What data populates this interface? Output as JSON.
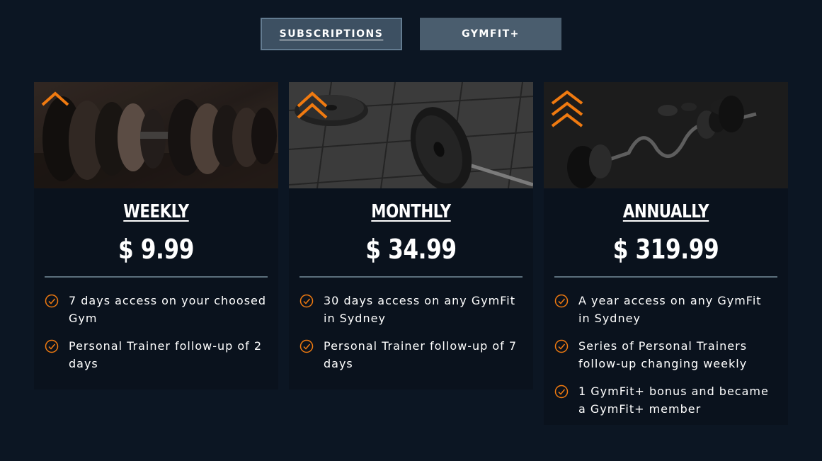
{
  "tabs": {
    "subscriptions": "SUBSCRIPTIONS",
    "gymfit_plus": "GYMFIT+"
  },
  "colors": {
    "accent": "#f07a10",
    "background": "#0c1623",
    "card": "#0a121d",
    "tab_active": "#3d5062",
    "tab_inactive": "#4a5d6e"
  },
  "plans": [
    {
      "title": "WEEKLY",
      "price": "$ 9.99",
      "tier_icon": "single-chevron-up-icon",
      "features": [
        "7 days access on your choosed Gym",
        "Personal Trainer follow-up of 2 days"
      ]
    },
    {
      "title": "MONTHLY",
      "price": "$ 34.99",
      "tier_icon": "double-chevron-up-icon",
      "features": [
        "30 days access on any GymFit in Sydney",
        "Personal Trainer follow-up of 7 days"
      ]
    },
    {
      "title": "ANNUALLY",
      "price": "$ 319.99",
      "tier_icon": "triple-chevron-up-icon",
      "features": [
        "A year access on any GymFit in Sydney",
        "Series of Personal Trainers follow-up changing weekly",
        "1 GymFit+ bonus and became a GymFit+ member"
      ]
    }
  ]
}
